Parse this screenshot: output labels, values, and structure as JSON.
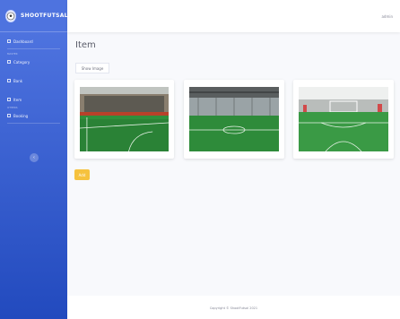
{
  "brand": {
    "name": "SHOOTFUTSAL",
    "icon": "football-logo-icon"
  },
  "sidebar": {
    "items": [
      {
        "label": "Dashboard",
        "icon": "dashboard-icon"
      },
      {
        "heading": "MASTER"
      },
      {
        "label": "Category",
        "icon": "category-icon"
      },
      {
        "label": "Bank",
        "icon": "bank-icon"
      },
      {
        "label": "Item",
        "icon": "item-icon"
      },
      {
        "heading": "OTHERS"
      },
      {
        "label": "Booking",
        "icon": "booking-icon"
      }
    ],
    "toggle_icon": "chevron-left-icon",
    "toggle_glyph": "‹"
  },
  "topbar": {
    "user_label": "admin"
  },
  "main": {
    "title": "Item",
    "show_images_label": "Show Image",
    "add_button_label": "Add",
    "cards": [
      {
        "name": "indoor-futsal-court-photo"
      },
      {
        "name": "futsal-court-center-photo"
      },
      {
        "name": "futsal-court-goal-photo"
      }
    ]
  },
  "footer": {
    "copyright": "Copyright © ShootFutsal 2021"
  },
  "colors": {
    "sidebar_start": "#4e73df",
    "sidebar_end": "#224abe",
    "add_button": "#f6c23e",
    "turf_green": "#2e8b3a"
  }
}
